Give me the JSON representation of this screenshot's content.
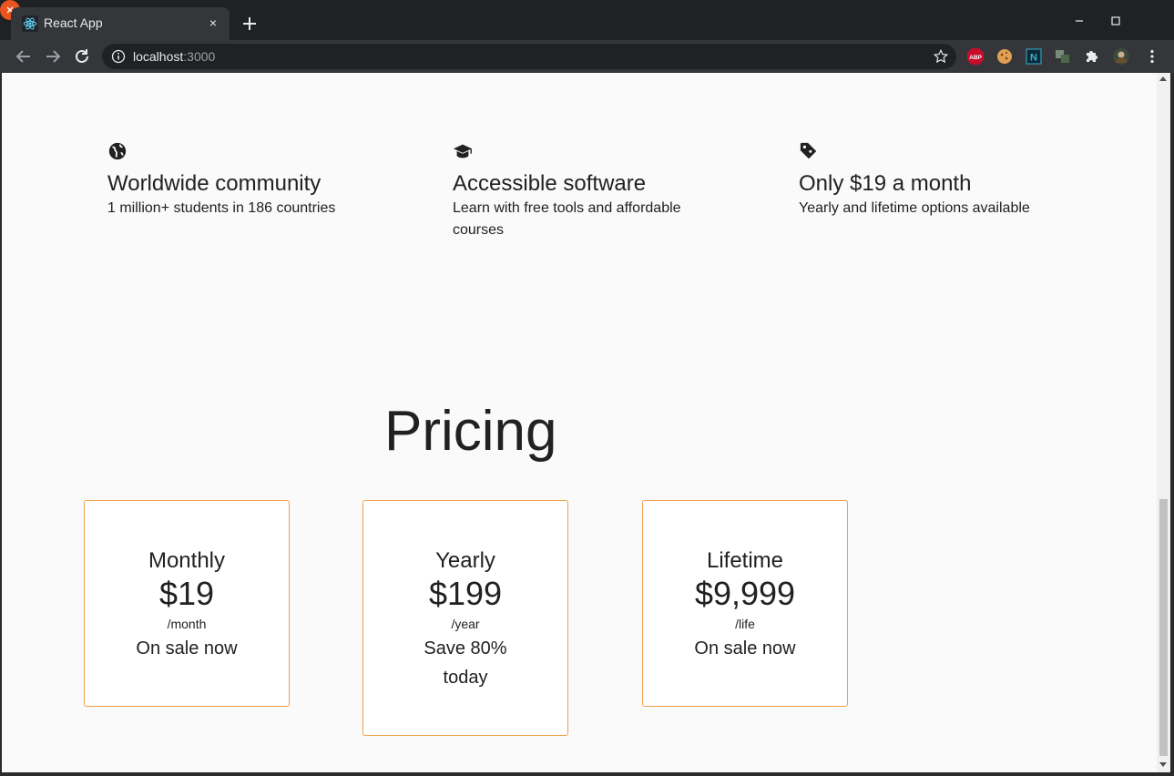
{
  "browser": {
    "tab_title": "React App",
    "tab_close": "×",
    "url_host": "localhost",
    "url_port": ":3000"
  },
  "features": [
    {
      "icon": "globe-icon",
      "title": "Worldwide community",
      "description": "1 million+ students in 186 countries"
    },
    {
      "icon": "graduation-cap-icon",
      "title": "Accessible software",
      "description": "Learn with free tools and affordable courses"
    },
    {
      "icon": "tag-icon",
      "title": "Only $19 a month",
      "description": "Yearly and lifetime options available"
    }
  ],
  "pricing": {
    "title": "Pricing",
    "plans": [
      {
        "name": "Monthly",
        "price": "$19",
        "period": "/month",
        "note": "On sale now"
      },
      {
        "name": "Yearly",
        "price": "$199",
        "period": "/year",
        "note": "Save 80% today"
      },
      {
        "name": "Lifetime",
        "price": "$9,999",
        "period": "/life",
        "note": "On sale now"
      }
    ]
  },
  "colors": {
    "card_border": "#f0a04b",
    "page_background": "#fafafa",
    "chrome_dark": "#202124",
    "close_button": "#e95420"
  }
}
